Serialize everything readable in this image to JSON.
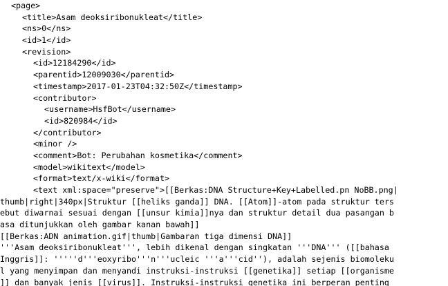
{
  "lines": [
    {
      "indent": 1,
      "text": "<page>"
    },
    {
      "indent": 2,
      "text": "<title>Asam deoksiribonukleat</title>"
    },
    {
      "indent": 2,
      "text": "<ns>0</ns>"
    },
    {
      "indent": 2,
      "text": "<id>1</id>"
    },
    {
      "indent": 2,
      "text": "<revision>"
    },
    {
      "indent": 3,
      "text": "<id>12184290</id>"
    },
    {
      "indent": 3,
      "text": "<parentid>12009030</parentid>"
    },
    {
      "indent": 3,
      "text": "<timestamp>2017-01-23T04:32:50Z</timestamp>"
    },
    {
      "indent": 3,
      "text": "<contributor>"
    },
    {
      "indent": 4,
      "text": "<username>HsfBot</username>"
    },
    {
      "indent": 4,
      "text": "<id>820984</id>"
    },
    {
      "indent": 3,
      "text": "</contributor>"
    },
    {
      "indent": 3,
      "text": "<minor />"
    },
    {
      "indent": 3,
      "text": "<comment>Bot: Perubahan kosmetika</comment>"
    },
    {
      "indent": 3,
      "text": "<model>wikitext</model>"
    },
    {
      "indent": 3,
      "text": "<format>text/x-wiki</format>"
    },
    {
      "indent": 3,
      "text": "<text xml:space=\"preserve\">[[Berkas:DNA Structure+Key+Labelled.pn NoBB.png|"
    },
    {
      "indent": 0,
      "text": "thumb|right|340px|Struktur [[heliks ganda]] DNA. [[Atom]]-atom pada struktur ters"
    },
    {
      "indent": 0,
      "text": "ebut diwarnai sesuai dengan [[unsur kimia]]nya dan struktur detail dua pasangan b"
    },
    {
      "indent": 0,
      "text": "asa ditunjukkan oleh gambar kanan bawah]]"
    },
    {
      "indent": 0,
      "text": "[[Berkas:ADN animation.gif|thumb|Gambaran tiga dimensi DNA]]"
    },
    {
      "indent": 0,
      "text": "'''Asam deoksiribonukleat''', lebih dikenal dengan singkatan '''DNA''' ([[bahasa"
    },
    {
      "indent": 0,
      "text": "Inggris]]: '''''d'''eoxyribo'''n'''ucleic '''a'''cid''), adalah sejenis biomoleku"
    },
    {
      "indent": 0,
      "text": "l yang menyimpan dan menyandi instruksi-instruksi [[genetika]] setiap [[organisme"
    },
    {
      "indent": 0,
      "text": "]] dan banyak jenis [[virus]]. Instruksi-instruksi genetika ini berperan penting"
    }
  ]
}
